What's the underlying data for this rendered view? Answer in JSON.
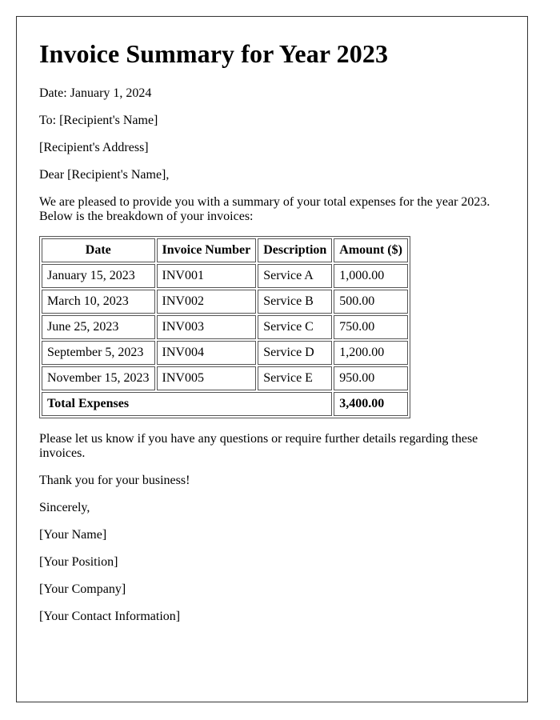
{
  "title": "Invoice Summary for Year 2023",
  "date_line": "Date: January 1, 2024",
  "to_line": "To: [Recipient's Name]",
  "address_line": "[Recipient's Address]",
  "greeting": "Dear [Recipient's Name],",
  "intro": "We are pleased to provide you with a summary of your total expenses for the year 2023. Below is the breakdown of your invoices:",
  "table": {
    "headers": [
      "Date",
      "Invoice Number",
      "Description",
      "Amount ($)"
    ],
    "rows": [
      {
        "date": "January 15, 2023",
        "invoice": "INV001",
        "description": "Service A",
        "amount": "1,000.00"
      },
      {
        "date": "March 10, 2023",
        "invoice": "INV002",
        "description": "Service B",
        "amount": "500.00"
      },
      {
        "date": "June 25, 2023",
        "invoice": "INV003",
        "description": "Service C",
        "amount": "750.00"
      },
      {
        "date": "September 5, 2023",
        "invoice": "INV004",
        "description": "Service D",
        "amount": "1,200.00"
      },
      {
        "date": "November 15, 2023",
        "invoice": "INV005",
        "description": "Service E",
        "amount": "950.00"
      }
    ],
    "total_label": "Total Expenses",
    "total_value": "3,400.00"
  },
  "closing_note": "Please let us know if you have any questions or require further details regarding these invoices.",
  "thanks": "Thank you for your business!",
  "signoff": "Sincerely,",
  "sender": {
    "name": "[Your Name]",
    "position": "[Your Position]",
    "company": "[Your Company]",
    "contact": "[Your Contact Information]"
  }
}
